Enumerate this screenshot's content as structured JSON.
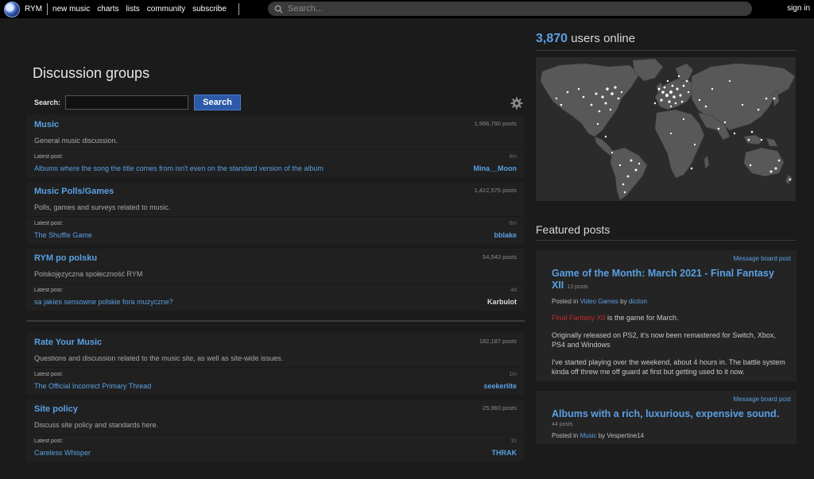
{
  "nav": {
    "brand": "RYM",
    "links": [
      "new music",
      "charts",
      "lists",
      "community",
      "subscribe"
    ],
    "search_placeholder": "Search...",
    "sign_in": "sign in"
  },
  "page": {
    "title": "Discussion groups",
    "search_label": "Search:",
    "search_button": "Search"
  },
  "groups_a": [
    {
      "name": "Music",
      "count": "1,996,790 posts",
      "desc": "General music discussion.",
      "latest_label": "Latest post:",
      "when": "4m",
      "thread": "Albums where the song the title comes from isn't even on the standard version of the album",
      "user": "Mina__Moon"
    },
    {
      "name": "Music Polls/Games",
      "count": "1,422,575 posts",
      "desc": "Polls, games and surveys related to music.",
      "latest_label": "Latest post:",
      "when": "6m",
      "thread": "The Shuffle Game",
      "user": "bblake"
    },
    {
      "name": "RYM po polsku",
      "count": "54,543 posts",
      "desc": "Polskojęzyczna społeczność RYM",
      "latest_label": "Latest post:",
      "when": "4d",
      "thread": "sa jakies sensowne polskie fora muzyczne?",
      "user": "Karbulot"
    }
  ],
  "groups_b": [
    {
      "name": "Rate Your Music",
      "count": "182,187 posts",
      "desc": "Questions and discussion related to the music site, as well as site-wide issues.",
      "latest_label": "Latest post:",
      "when": "1m",
      "thread": "The Official Incorrect Primary Thread",
      "user": "seekerlite"
    },
    {
      "name": "Site policy",
      "count": "25,960 posts",
      "desc": "Discuss site policy and standards here.",
      "latest_label": "Latest post:",
      "when": "1h",
      "thread": "Careless Whisper",
      "user": "THRAK"
    }
  ],
  "sidebar": {
    "online_count": "3,870",
    "online_label": "users online",
    "featured_title": "Featured posts",
    "posts": [
      {
        "type": "Message board post",
        "title": "Game of the Month: March 2021 - Final Fantasy XII",
        "count": "13 posts",
        "posted_in": "Posted in",
        "board": "Video Games",
        "by": "by",
        "author": "diction",
        "highlight": "Final Fantasy XII",
        "p1_rest": " is the game for March.",
        "p2": "Originally released on PS2, it's now been remastered for Switch, Xbox, PS4 and Windows",
        "p3": "I've started playing over the weekend, about 4 hours in. The battle system kinda off threw me off guard at first but getting used to it now."
      },
      {
        "type": "Message board post",
        "title": "Albums with a rich, luxurious, expensive sound.",
        "count": "44 posts",
        "posted_in": "Posted in",
        "board": "Music",
        "by": "by",
        "author": "Vespertine14"
      }
    ]
  },
  "colors": {
    "accent": "#5aa0e3",
    "button": "#2d5aa8",
    "highlight": "#c0282a"
  }
}
